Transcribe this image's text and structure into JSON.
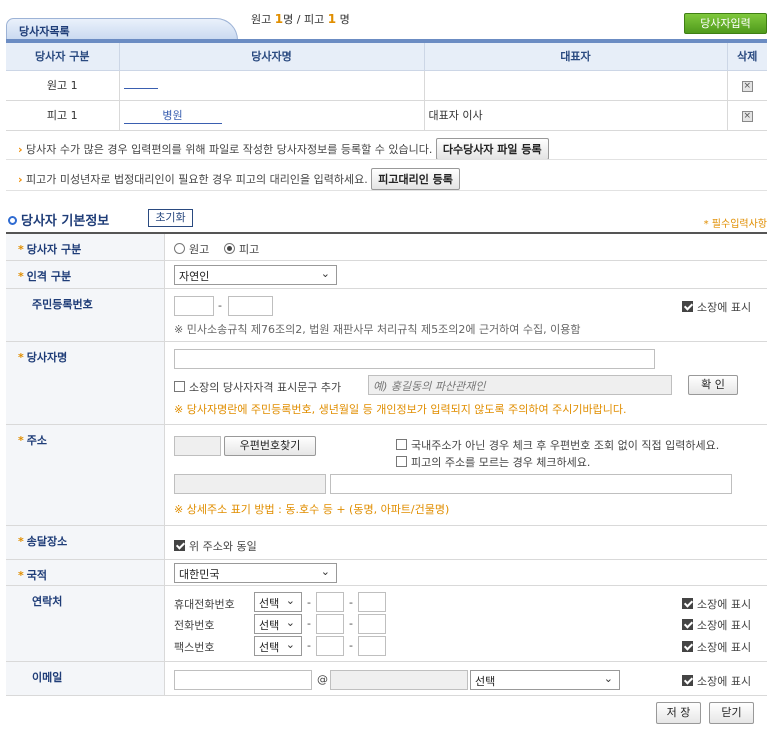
{
  "tab": {
    "title": "당사자목록"
  },
  "counts": {
    "plaintiff_label": "원고",
    "plaintiff_count": "1",
    "plaintiff_unit": "명",
    "sep": "/",
    "defendant_label": "피고",
    "defendant_count": "1",
    "defendant_unit": "명"
  },
  "add_button": "당사자입력",
  "table": {
    "headers": [
      "당사자 구분",
      "당사자명",
      "대표자",
      "삭제"
    ],
    "rows": [
      {
        "type": "원고 1",
        "name": "",
        "rep": ""
      },
      {
        "type": "피고 1",
        "name": "병원",
        "rep": "대표자 이사"
      }
    ]
  },
  "notes": {
    "multi_text": "당사자 수가 많은 경우 입력편의를 위해 파일로 작성한 당사자정보를 등록할 수 있습니다.",
    "multi_button": "다수당사자 파일 등록",
    "agent_text": "피고가 미성년자로 법정대리인이 필요한 경우 피고의 대리인을 입력하세요.",
    "agent_button": "피고대리인 등록"
  },
  "section": {
    "title": "당사자 기본정보",
    "reset_button": "초기화",
    "required_note": "* 필수입력사항"
  },
  "form": {
    "party_type": {
      "label": "당사자 구분",
      "opt1": "원고",
      "opt2": "피고",
      "selected": "피고"
    },
    "person_type": {
      "label": "인격 구분",
      "value": "자연인"
    },
    "resident": {
      "label": "주민등록번호",
      "dash": "-",
      "show_label": "소장에 표시",
      "notice": "※ 민사소송규칙 제76조의2, 법원 재판사무 처리규칙 제5조의2에 근거하여 수집, 이용함"
    },
    "name": {
      "label": "당사자명",
      "qual_label": "소장의 당사자자격 표시문구 추가",
      "qual_placeholder": "예) 홍길동의 파산관재인",
      "confirm_button": "확 인",
      "warning": "※ 당사자명란에 주민등록번호, 생년월일 등 개인정보가 입력되지 않도록 주의하여 주시기바랍니다."
    },
    "address": {
      "label": "주소",
      "zip_button": "우편번호찾기",
      "check1": "국내주소가 아닌 경우 체크 후 우편번호 조회 없이 직접 입력하세요.",
      "check2": "피고의 주소를 모르는 경우 체크하세요.",
      "hint": "※ 상세주소 표기 방법 : 동.호수 등 + (동명, 아파트/건물명)"
    },
    "delivery": {
      "label": "송달장소",
      "same_label": "위 주소와 동일"
    },
    "nationality": {
      "label": "국적",
      "value": "대한민국"
    },
    "contact": {
      "label": "연락처",
      "select_default": "선택",
      "dash": "-",
      "show_label": "소장에 표시",
      "lines": [
        "휴대전화번호",
        "전화번호",
        "팩스번호"
      ]
    },
    "email": {
      "label": "이메일",
      "at": "@",
      "select_default": "선택",
      "show_label": "소장에 표시"
    }
  },
  "footer": {
    "save": "저 장",
    "close": "닫기"
  }
}
